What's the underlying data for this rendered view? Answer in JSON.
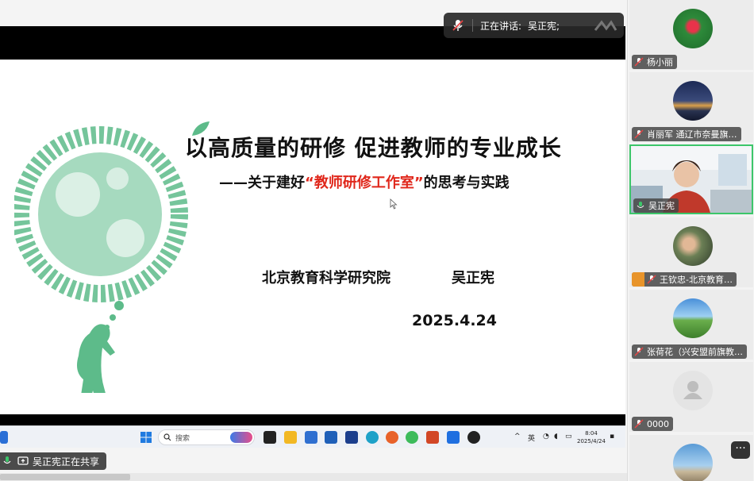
{
  "banner": {
    "label": "正在讲话:",
    "speaker": "吴正宪;"
  },
  "slide": {
    "title": "以高质量的研修 促进教师的专业成长",
    "subtitle_prefix": "——关于建好",
    "subtitle_highlight": "“教师研修工作室”",
    "subtitle_suffix": "的思考与实践",
    "org": "北京教育科学研究院",
    "author": "吴正宪",
    "date": "2025.4.24"
  },
  "taskbar": {
    "search_placeholder": "搜索",
    "ime": "英",
    "time": "8:04",
    "date": "2025/4/24"
  },
  "share_status": {
    "text": "吴正宪正在共享"
  },
  "participants": [
    {
      "name": "杨小丽"
    },
    {
      "name": "肖丽军 通辽市奈曼旗…"
    },
    {
      "name": "吴正宪"
    },
    {
      "name": "王钦忠-北京教育…"
    },
    {
      "name": "张荷花（兴安盟前旗教…"
    },
    {
      "name": "0000"
    }
  ],
  "more_label": "···",
  "colors": {
    "accent_green": "#3cc66a",
    "slide_red": "#e0271b",
    "art_green": "#5dbb8a"
  }
}
